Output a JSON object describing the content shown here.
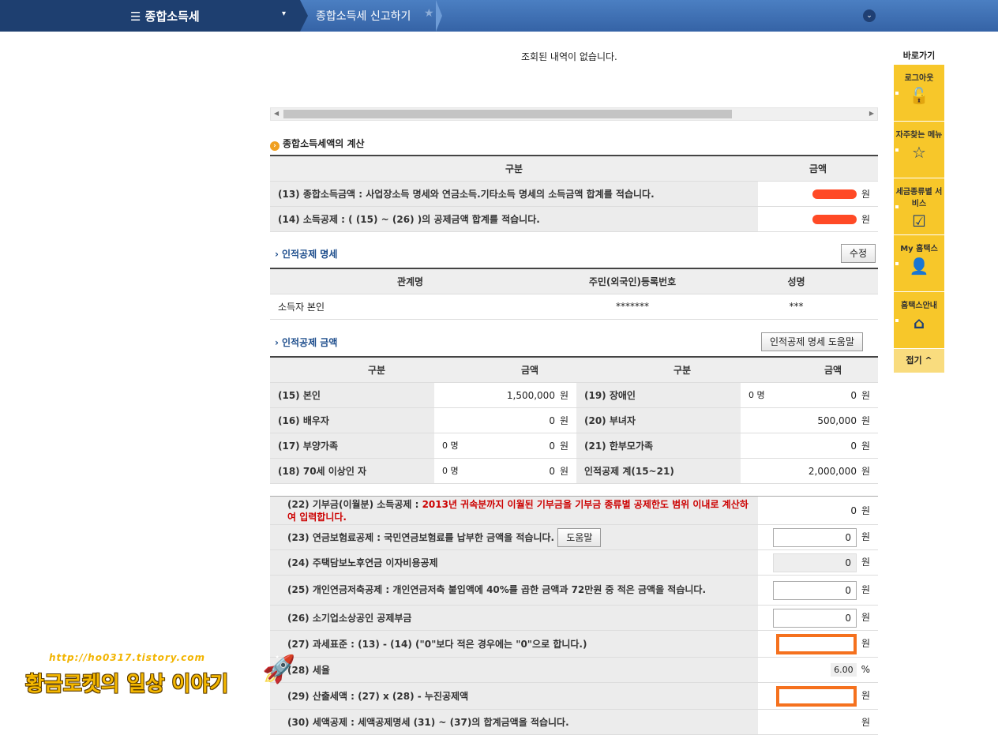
{
  "topbar": {
    "menu_label": "☰ 종합소득세",
    "menu_caret": "▾",
    "breadcrumb": "종합소득세 신고하기",
    "star": "★",
    "chevron": "⌄"
  },
  "no_result": "조회된 내역이 없습니다.",
  "section_title": "종합소득세액의 계산",
  "main_table": {
    "headers": [
      "구분",
      "금액"
    ],
    "rows": [
      {
        "label": "(13) 종합소득금액 : 사업장소득 명세와 연금소득.기타소득 명세의 소득금액 합계를 적습니다.",
        "unit": "원"
      },
      {
        "label": "(14) 소득공제 : ( (15) ~ (26) )의 공제금액 합계를 적습니다.",
        "unit": "원"
      }
    ]
  },
  "personal_detail": {
    "title": "인적공제 명세",
    "edit_button": "수정",
    "headers": [
      "관계명",
      "주민(외국인)등록번호",
      "성명"
    ],
    "rows": [
      [
        "소득자 본인",
        "*******",
        "***"
      ]
    ]
  },
  "personal_amount": {
    "title": "인적공제 금액",
    "help_button": "인적공제 명세 도움말",
    "headers": [
      "구분",
      "금액",
      "구분",
      "금액"
    ],
    "rows": [
      {
        "l_label": "(15) 본인",
        "l_count": "",
        "l_amount": "1,500,000",
        "r_label": "(19) 장애인",
        "r_count": "0 명",
        "r_amount": "0"
      },
      {
        "l_label": "(16) 배우자",
        "l_count": "",
        "l_amount": "0",
        "r_label": "(20) 부녀자",
        "r_count": "",
        "r_amount": "500,000"
      },
      {
        "l_label": "(17) 부양가족",
        "l_count": "0 명",
        "l_amount": "0",
        "r_label": "(21) 한부모가족",
        "r_count": "",
        "r_amount": "0"
      },
      {
        "l_label": "(18) 70세 이상인 자",
        "l_count": "0 명",
        "l_amount": "0",
        "r_label": "인적공제 계(15~21)",
        "r_count": "",
        "r_amount": "2,000,000"
      }
    ],
    "unit": "원"
  },
  "deductions": {
    "r22_label": "(22) 기부금(이월분) 소득공제 : ",
    "r22_red": "2013년 귀속분까지 이월된 기부금을 기부금 종류별 공제한도 범위 이내로 계산하여 입력합니다.",
    "r22_value": "0",
    "r23_label": "(23) 연금보험료공제 : 국민연금보험료를 납부한 금액을 적습니다.",
    "r23_help": "도움말",
    "r23_value": "0",
    "r24_label": "(24) 주택담보노후연금 이자비용공제",
    "r24_value": "0",
    "r25_label": "(25) 개인연금저축공제 : 개인연금저축 불입액에 40%를 곱한 금액과 72만원 중 적은 금액을 적습니다.",
    "r25_value": "0",
    "r26_label": "(26) 소기업소상공인 공제부금",
    "r26_value": "0",
    "r27_label": "(27) 과세표준 : (13) - (14) (\"0\"보다 적은 경우에는 \"0\"으로 합니다.)",
    "r28_label": "(28) 세율",
    "r28_value": "6.00",
    "r28_unit": "%",
    "r29_label": "(29) 산출세액 : (27) x (28) - 누진공제액",
    "r30_label": "(30) 세액공제 : 세액공제명세 (31) ~ (37)의 합계금액을 적습니다.",
    "unit": "원"
  },
  "sidebar": {
    "header": "바로가기",
    "items": [
      {
        "label": "로그아웃",
        "icon": "🔓"
      },
      {
        "label": "자주찾는 메뉴",
        "icon": "☆"
      },
      {
        "label": "세금종류별 서비스",
        "icon": "☑"
      },
      {
        "label": "My 홈택스",
        "icon": "👤"
      },
      {
        "label": "홈택스안내",
        "icon": "⌂"
      }
    ],
    "fold": "접기 ^"
  },
  "watermark": {
    "url": "http://ho0317.tistory.com",
    "title": "황금로켓의 일상 이야기",
    "rocket": "🚀"
  }
}
